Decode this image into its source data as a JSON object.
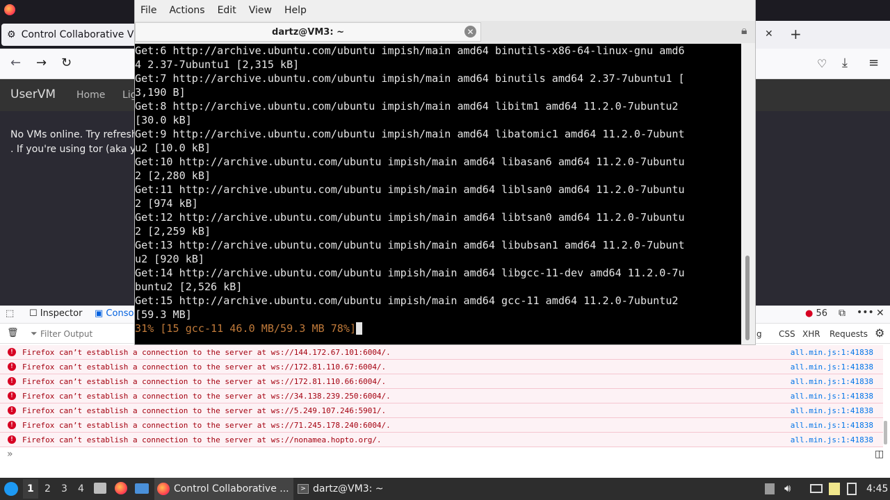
{
  "browser": {
    "tab_title": "Control Collaborative Vi",
    "nav": {
      "back": "←",
      "forward": "→",
      "reload": "↻"
    }
  },
  "page": {
    "brand": "UserVM",
    "nav_home": "Home",
    "nav_partial": "Lig",
    "message_line1": "No VMs online. Try refreshin",
    "message_line2": ". If you're using tor (aka you c"
  },
  "devtools": {
    "tab_inspector": "Inspector",
    "tab_console": "Conso",
    "error_count": "56",
    "filter_placeholder": "Filter Output",
    "filter_partial": "g",
    "filters": [
      "CSS",
      "XHR",
      "Requests"
    ],
    "logs": [
      {
        "msg": "Firefox can’t establish a connection to the server at ws://144.172.67.101:6004/.",
        "src": "all.min.js:1:41838"
      },
      {
        "msg": "Firefox can’t establish a connection to the server at ws://172.81.110.67:6004/.",
        "src": "all.min.js:1:41838"
      },
      {
        "msg": "Firefox can’t establish a connection to the server at ws://172.81.110.66:6004/.",
        "src": "all.min.js:1:41838"
      },
      {
        "msg": "Firefox can’t establish a connection to the server at ws://34.138.239.250:6004/.",
        "src": "all.min.js:1:41838"
      },
      {
        "msg": "Firefox can’t establish a connection to the server at ws://5.249.107.246:5901/.",
        "src": "all.min.js:1:41838"
      },
      {
        "msg": "Firefox can’t establish a connection to the server at ws://71.245.178.240:6004/.",
        "src": "all.min.js:1:41838"
      },
      {
        "msg": "Firefox can’t establish a connection to the server at ws://nonamea.hopto.org/.",
        "src": "all.min.js:1:41838"
      }
    ],
    "prompt": "»"
  },
  "terminal": {
    "menu": [
      "File",
      "Actions",
      "Edit",
      "View",
      "Help"
    ],
    "tab_title": "dartz@VM3: ~",
    "lines": [
      "Get:6 http://archive.ubuntu.com/ubuntu impish/main amd64 binutils-x86-64-linux-gnu amd6",
      "4 2.37-7ubuntu1 [2,315 kB]",
      "Get:7 http://archive.ubuntu.com/ubuntu impish/main amd64 binutils amd64 2.37-7ubuntu1 [",
      "3,190 B]",
      "Get:8 http://archive.ubuntu.com/ubuntu impish/main amd64 libitm1 amd64 11.2.0-7ubuntu2",
      "[30.0 kB]",
      "Get:9 http://archive.ubuntu.com/ubuntu impish/main amd64 libatomic1 amd64 11.2.0-7ubunt",
      "u2 [10.0 kB]",
      "Get:10 http://archive.ubuntu.com/ubuntu impish/main amd64 libasan6 amd64 11.2.0-7ubuntu",
      "2 [2,280 kB]",
      "Get:11 http://archive.ubuntu.com/ubuntu impish/main amd64 liblsan0 amd64 11.2.0-7ubuntu",
      "2 [974 kB]",
      "Get:12 http://archive.ubuntu.com/ubuntu impish/main amd64 libtsan0 amd64 11.2.0-7ubuntu",
      "2 [2,259 kB]",
      "Get:13 http://archive.ubuntu.com/ubuntu impish/main amd64 libubsan1 amd64 11.2.0-7ubunt",
      "u2 [920 kB]",
      "Get:14 http://archive.ubuntu.com/ubuntu impish/main amd64 libgcc-11-dev amd64 11.2.0-7u",
      "buntu2 [2,526 kB]",
      "Get:15 http://archive.ubuntu.com/ubuntu impish/main amd64 gcc-11 amd64 11.2.0-7ubuntu2",
      "[59.3 MB]"
    ],
    "progress_line": "31% [15 gcc-11 46.0 MB/59.3 MB 78%]"
  },
  "taskbar": {
    "workspaces": [
      "1",
      "2",
      "3",
      "4"
    ],
    "task_browser": "Control Collaborative ...",
    "task_terminal": "dartz@VM3: ~",
    "clock": "4:45"
  }
}
